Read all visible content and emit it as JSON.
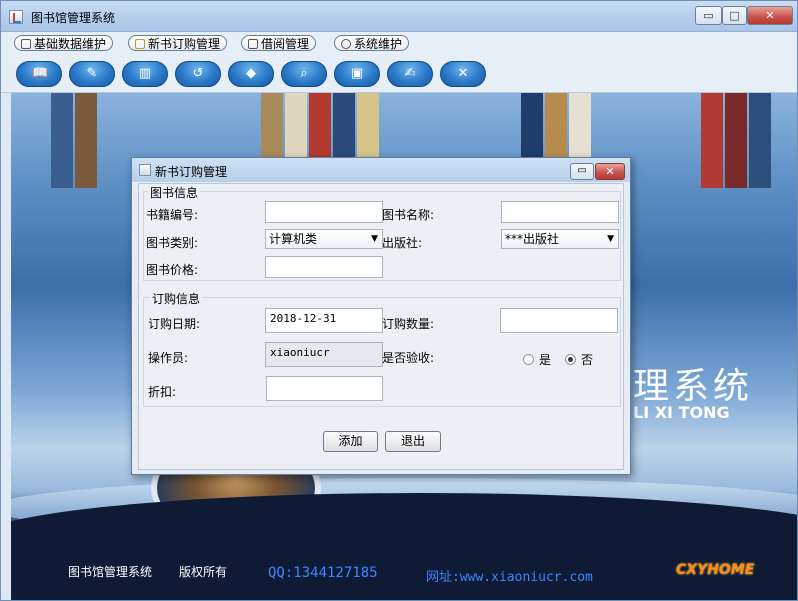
{
  "window": {
    "title": "图书馆管理系统",
    "min_glyph": "▭",
    "max_glyph": "□",
    "close_glyph": "✕"
  },
  "menu": [
    {
      "label": "基础数据维护",
      "icon": "database-icon"
    },
    {
      "label": "新书订购管理",
      "icon": "cart-icon"
    },
    {
      "label": "借阅管理",
      "icon": "lock-icon"
    },
    {
      "label": "系统维护",
      "icon": "gear-icon"
    }
  ],
  "toolbar": [
    {
      "icon": "book-icon",
      "glyph": "📖"
    },
    {
      "icon": "pen-icon",
      "glyph": "✎"
    },
    {
      "icon": "books-icon",
      "glyph": "▥"
    },
    {
      "icon": "return-icon",
      "glyph": "↺"
    },
    {
      "icon": "box-icon",
      "glyph": "◆"
    },
    {
      "icon": "search-icon",
      "glyph": "⌕"
    },
    {
      "icon": "monitor-icon",
      "glyph": "▣"
    },
    {
      "icon": "user-icon",
      "glyph": "✍"
    },
    {
      "icon": "exit-icon",
      "glyph": "✕"
    }
  ],
  "background": {
    "big_title": "理系统",
    "sub_title": "LI XI TONG",
    "footer_name": "图书馆管理系统",
    "footer_rights": "版权所有",
    "footer_qq": "QQ:1344127185",
    "footer_web": "网址:www.xiaoniucr.com",
    "brand": "CXYHOME"
  },
  "dialog": {
    "title": "新书订购管理",
    "min_glyph": "▭",
    "close_glyph": "✕",
    "book_group": {
      "title": "图书信息",
      "isbn_label": "书籍编号:",
      "isbn_value": "",
      "name_label": "图书名称:",
      "name_value": "",
      "category_label": "图书类别:",
      "category_value": "计算机类",
      "publisher_label": "出版社:",
      "publisher_value": "***出版社",
      "price_label": "图书价格:",
      "price_value": ""
    },
    "order_group": {
      "title": "订购信息",
      "date_label": "订购日期:",
      "date_value": "2018-12-31",
      "qty_label": "订购数量:",
      "qty_value": "",
      "operator_label": "操作员:",
      "operator_value": "xiaoniucr",
      "accepted_label": "是否验收:",
      "yes_label": "是",
      "no_label": "否",
      "accepted_value": "否",
      "discount_label": "折扣:",
      "discount_value": ""
    },
    "add_label": "添加",
    "exit_label": "退出"
  }
}
